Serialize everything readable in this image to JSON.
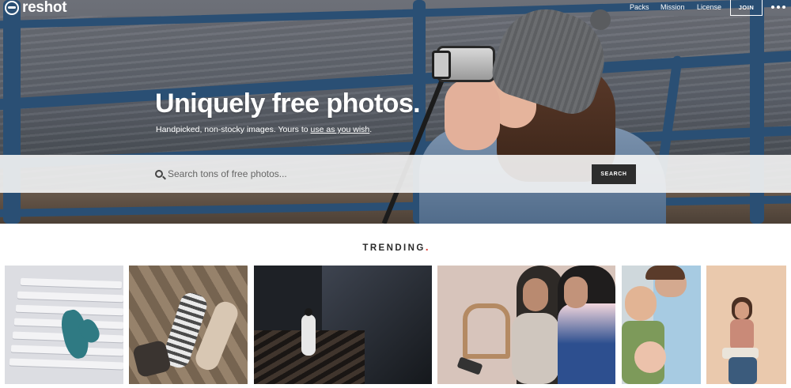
{
  "header": {
    "logo_text": "reshot",
    "nav": [
      "Packs",
      "Mission",
      "License"
    ],
    "join_label": "JOIN",
    "more_icon": "more-dots-icon"
  },
  "hero": {
    "title": "Uniquely free photos.",
    "subtitle_prefix": "Handpicked, non-stocky images. Yours to ",
    "subtitle_link": "use as you wish",
    "subtitle_suffix": "."
  },
  "search": {
    "placeholder": "Search tons of free photos...",
    "button_label": "SEARCH",
    "icon": "search-icon"
  },
  "trending": {
    "title": "TRENDING",
    "dot": ".",
    "dot_color": "#e0443a",
    "thumbnails": [
      {
        "subject": "mittens on snowy bench"
      },
      {
        "subject": "people lying on floor"
      },
      {
        "subject": "person on dark staircase"
      },
      {
        "subject": "women in hijabs looking at phone"
      },
      {
        "subject": "mother with baby and child"
      },
      {
        "subject": "woman reading on stool"
      }
    ]
  },
  "colors": {
    "rail": "#2a4f74",
    "button_dark": "#2d2d2d",
    "accent_dot": "#e0443a"
  }
}
